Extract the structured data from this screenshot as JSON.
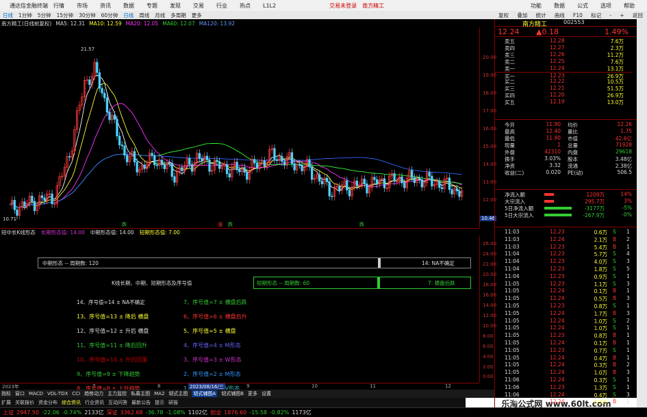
{
  "titlebar": {
    "app": "通达信金融终端",
    "menus": [
      "行情",
      "市场",
      "资讯",
      "数据",
      "专题",
      "发现",
      "交易",
      "行业",
      "热点",
      "L1L2"
    ],
    "login": "交易未登录",
    "stock": "南方精工",
    "right": [
      "功能",
      "数据",
      "公式",
      "选项",
      "帮助"
    ]
  },
  "periods": [
    "日线",
    "1分钟",
    "5分钟",
    "15分钟",
    "30分钟",
    "60分钟",
    "日线",
    "周线",
    "月线",
    "多周期",
    "更多"
  ],
  "rtools": [
    "复权",
    "叠加",
    "统计",
    "画线",
    "F10",
    "标记",
    "-",
    "+",
    "返回"
  ],
  "chart_head": {
    "name": "南方精工(日线前复权)",
    "ma5": "MA5: 12.31",
    "ma10": "MA10: 12.59",
    "ma20": "MA20: 12.05",
    "ma60": "MA60: 12.07",
    "ma120": "MA120: 13.92",
    "high": "21.57",
    "low": "10.71"
  },
  "chart_colors": {
    "up": "#ff3b3b",
    "down": "#4fd1ff",
    "ma5": "#ffffff",
    "ma10": "#ffff33",
    "ma20": "#ff33ff",
    "ma60": "#33ff33",
    "ma120": "#3366ff"
  },
  "yaxis": [
    "20.00",
    "19.00",
    "18.00",
    "17.00",
    "16.00",
    "15.00",
    "14.00",
    "13.00",
    "12.00",
    "10.46"
  ],
  "markers": [
    "跌",
    "涨",
    "跌",
    "跌"
  ],
  "indicator": {
    "title": "短中长K线形态",
    "long": "长期形态值: 14.00",
    "mid": "中期形态值: 14.00",
    "short": "短期形态值: 7.00"
  },
  "y2": [
    "26.00",
    "24.00",
    "22.00",
    "20.00",
    "18.00",
    "16.00",
    "14.00",
    "12.00",
    "10.00",
    "8.00",
    "6.00",
    "4.00",
    "2.00",
    "0.00"
  ],
  "mid_box": {
    "left": "中期形态 -- 周期数: 120",
    "right": "14: NA不确定"
  },
  "short_box": {
    "left": "短期形态 -- 周期数: 60",
    "right": "7: 横盘后跌"
  },
  "caption": "K线长期、中期、短期形态及序号值",
  "legend_left": [
    {
      "t": "14、序号值=14 ± NA不确定",
      "c": "#ddd"
    },
    {
      "t": "13、序号值=13 ± 降后 横盘",
      "c": "#ff3"
    },
    {
      "t": "12、序号值=12 ± 升后 横盘",
      "c": "#ddd"
    },
    {
      "t": "11、序号值=11 ± 降后回升",
      "c": "#3c3"
    },
    {
      "t": "10、序号值=10 ± 升后回落",
      "c": "#c00"
    },
    {
      "t": "9、序号值=9 ± 下降趋势",
      "c": "#3c3"
    },
    {
      "t": "8、序号值=8 ± 上升趋势",
      "c": "#f33"
    }
  ],
  "legend_right": [
    {
      "t": "7、序号值=7 ± 横盘后跌",
      "c": "#3c3"
    },
    {
      "t": "6、序号值=6 ± 横盘后升",
      "c": "#f33"
    },
    {
      "t": "5、序号值=5 ± 横盘",
      "c": "#ff3"
    },
    {
      "t": "4、序号值=4 ± M形态",
      "c": "#66f"
    },
    {
      "t": "3、序号值=3 ± W形态",
      "c": "#c3c"
    },
    {
      "t": "2、序号值=2 ± M形态",
      "c": "#39f"
    },
    {
      "t": "1、序号值=1 ± V形态",
      "c": "#3cc"
    }
  ],
  "xaxis": {
    "year": "2023年",
    "date": "2023/08/16/三",
    "marks": [
      "7",
      "8",
      "9",
      "10",
      "11",
      "12"
    ]
  },
  "tabs": [
    "指标",
    "窗口",
    "MACD",
    "VOL-TDX",
    "CCI",
    "趋势动力",
    "主力监控",
    "私募主图",
    "MA2",
    "韧式主图",
    "韧式辅图A",
    "韧式辅图B",
    "更多",
    "设置"
  ],
  "tabs2": [
    "扩展",
    "关联报价",
    "资金分布",
    "综合资讯",
    "行业资讯",
    "互动问答",
    "最新公告",
    "提示",
    "研报"
  ],
  "bottom": [
    {
      "t": "上证",
      "c": "#f33"
    },
    {
      "t": "2947.50",
      "c": "#f33"
    },
    {
      "t": "-22.06",
      "c": "#3c3"
    },
    {
      "t": "-0.74%",
      "c": "#3c3"
    },
    {
      "t": "2133亿",
      "c": "#ddd"
    },
    {
      "t": "深证",
      "c": "#f33"
    },
    {
      "t": "3362.68",
      "c": "#f33"
    },
    {
      "t": "-36.78",
      "c": "#3c3"
    },
    {
      "t": "-1.08%",
      "c": "#3c3"
    },
    {
      "t": "1102亿",
      "c": "#ddd"
    },
    {
      "t": "创业",
      "c": "#f33"
    },
    {
      "t": "1876.60",
      "c": "#f33"
    },
    {
      "t": "-15.58",
      "c": "#3c3"
    },
    {
      "t": "-0.82%",
      "c": "#3c3"
    },
    {
      "t": "1173亿",
      "c": "#ddd"
    }
  ],
  "quote": {
    "name": "南方精工",
    "code": "002553",
    "price": "12.24",
    "change": "▲0.18",
    "pct": "1.49%"
  },
  "orderbook": [
    [
      "卖五",
      "12.28",
      "7.6万"
    ],
    [
      "卖四",
      "12.27",
      "2.3万"
    ],
    [
      "卖三",
      "12.26",
      "11.2万"
    ],
    [
      "卖二",
      "12.25",
      "7.6万"
    ],
    [
      "卖一",
      "12.24",
      "13.1万"
    ],
    [
      "买一",
      "12.23",
      "26.9万"
    ],
    [
      "买二",
      "12.22",
      "10.5万"
    ],
    [
      "买三",
      "12.21",
      "51.5万"
    ],
    [
      "买四",
      "12.20",
      "26.9万"
    ],
    [
      "买五",
      "12.19",
      "13.0万"
    ]
  ],
  "stats": [
    [
      "今开",
      "11.90",
      "均价",
      "12.26"
    ],
    [
      "最高",
      "12.40",
      "量比",
      "1.75"
    ],
    [
      "最低",
      "11.90",
      "市值",
      "42.6亿"
    ],
    [
      "现量",
      "1",
      "总量",
      "71928"
    ],
    [
      "外盘",
      "42310",
      "内盘",
      "29618"
    ],
    [
      "换手",
      "3.03%",
      "股本",
      "3.48亿"
    ],
    [
      "净资",
      "3.32",
      "流通",
      "2.38亿"
    ],
    [
      "收益(二)",
      "0.020",
      "PE(动)",
      "506.5"
    ]
  ],
  "flows": [
    [
      "净流入额",
      "1209万",
      "14%"
    ],
    [
      "大宗流入",
      "295.7万",
      "3%"
    ],
    [
      "5日净流入额",
      "-3177万",
      "-5%"
    ],
    [
      "5日大宗流入",
      "-267.9万",
      "-0%"
    ]
  ],
  "ticks": [
    [
      "11:03",
      "12.23",
      "0.6万",
      "S",
      "1"
    ],
    [
      "11:03",
      "12.24",
      "2.1万",
      "B",
      "2"
    ],
    [
      "11:03",
      "12.23",
      "5.4万",
      "B",
      "1"
    ],
    [
      "11:04",
      "12.23",
      "5.7万",
      "S",
      "4"
    ],
    [
      "11:04",
      "12.23",
      "4.0万",
      "S",
      "3"
    ],
    [
      "11:04",
      "12.23",
      "1.8万",
      "S",
      "5"
    ],
    [
      "11:04",
      "12.23",
      "0.9万",
      "S",
      "1"
    ],
    [
      "11:05",
      "12.23",
      "1.1万",
      "S",
      "3"
    ],
    [
      "11:05",
      "12.24",
      "0.1万",
      "B",
      "1"
    ],
    [
      "11:05",
      "12.24",
      "0.5万",
      "B",
      "3"
    ],
    [
      "11:05",
      "12.23",
      "0.8万",
      "S",
      "1"
    ],
    [
      "11:05",
      "12.24",
      "1.7万",
      "B",
      "3"
    ],
    [
      "11:05",
      "12.24",
      "1.0万",
      "S",
      "2"
    ],
    [
      "11:05",
      "12.24",
      "1.0万",
      "S",
      "1"
    ],
    [
      "11:05",
      "12.23",
      "0.8万",
      "B",
      "1"
    ],
    [
      "11:05",
      "12.24",
      "0.1万",
      "B",
      "1"
    ],
    [
      "11:05",
      "12.23",
      "0.7万",
      "S",
      "1"
    ],
    [
      "11:05",
      "12.24",
      "0.4万",
      "B",
      "1"
    ],
    [
      "11:05",
      "12.24",
      "0.3万",
      "B",
      "2"
    ],
    [
      "11:05",
      "12.24",
      "1.0万",
      "B",
      "3"
    ],
    [
      "11:06",
      "12.24",
      "0.3万",
      "S",
      "1"
    ],
    [
      "11:06",
      "12.23",
      "1.3万",
      "S",
      "1"
    ],
    [
      "11:06",
      "12.24",
      "0.4万",
      "S",
      "3"
    ],
    [
      "11:06",
      "12.24",
      "0.3万",
      "B",
      "2"
    ]
  ],
  "watermark": "乐淘公式网 www.60lt.com"
}
